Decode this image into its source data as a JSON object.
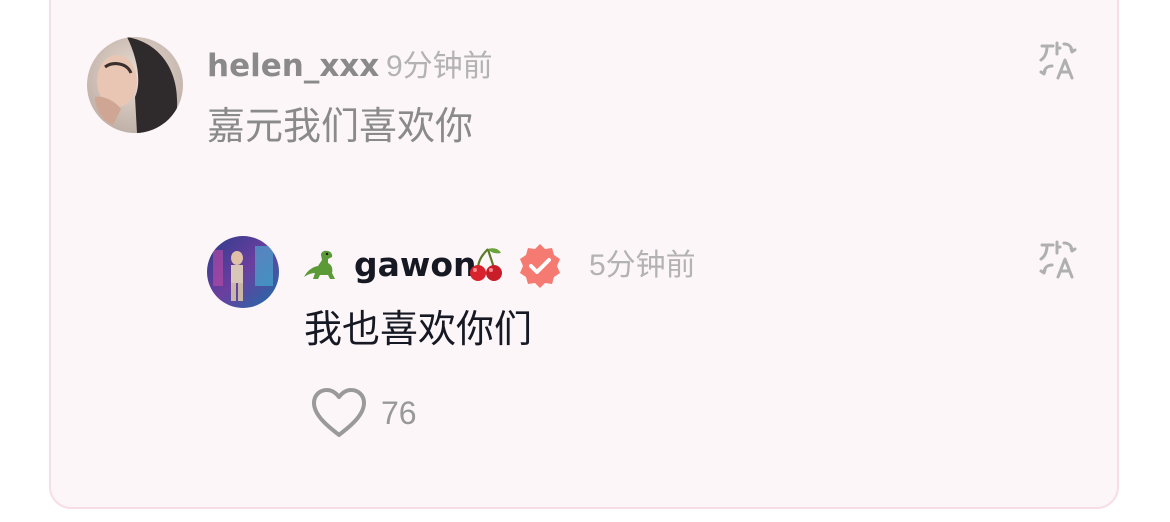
{
  "comments": [
    {
      "username": "helen_xxx",
      "time": "9分钟前",
      "text": "嘉元我们喜欢你",
      "avatar": "user-avatar-photo",
      "translate_icon": "translate-icon"
    }
  ],
  "replies": [
    {
      "username": "gawon",
      "prefix_emoji": "dinosaur-emoji",
      "suffix_emoji": "cherry-emoji",
      "verified_badge": "verified-check-icon",
      "time": "5分钟前",
      "text": "我也喜欢你们",
      "avatar": "user-avatar-stage-photo",
      "translate_icon": "translate-icon",
      "like_icon": "heart-outline-icon",
      "like_count": "76"
    }
  ],
  "colors": {
    "card_background": "#fcf6f8",
    "card_border": "#f7dde5",
    "verified_badge": "#f47a72",
    "secondary_text": "#b3b3b3",
    "primary_text": "#161823"
  }
}
